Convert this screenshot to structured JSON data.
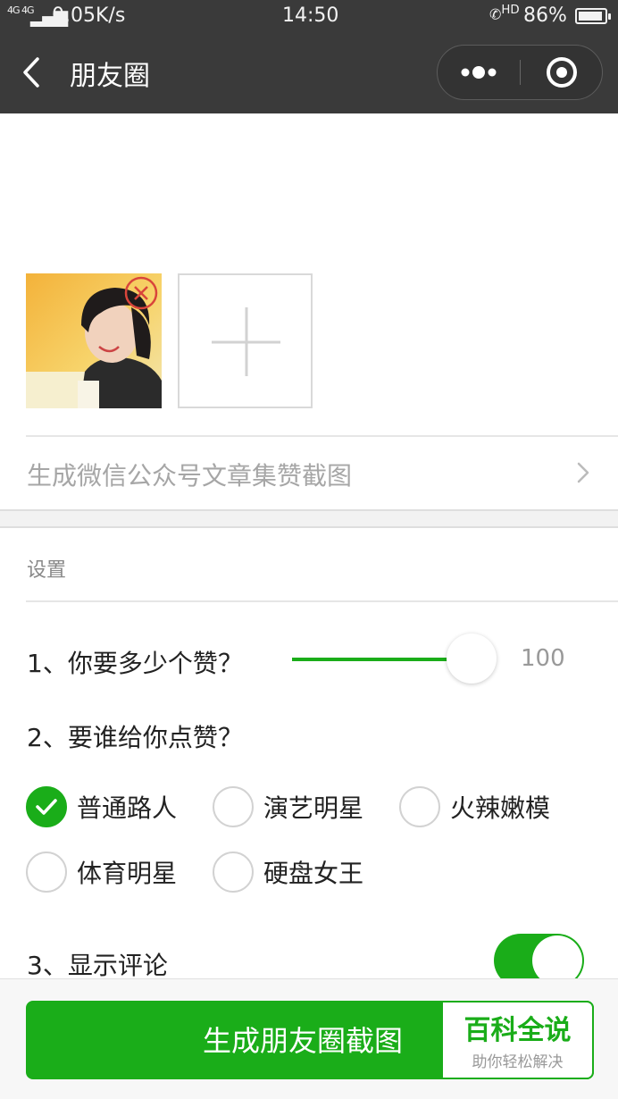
{
  "status_bar": {
    "network": "4G 4G",
    "speed": "0.05K/s",
    "time": "14:50",
    "hd_badge": "HD",
    "battery_percent": "86%",
    "battery_level": 0.86
  },
  "nav": {
    "title": "朋友圈",
    "icons": [
      "back-chevron-icon",
      "more-dots-icon",
      "close-target-icon"
    ]
  },
  "images": {
    "thumbnail_icon": "remove-x-icon",
    "add_icon": "plus-icon"
  },
  "article_link": {
    "label": "生成微信公众号文章集赞截图",
    "icon": "chevron-right-icon"
  },
  "settings": {
    "header": "设置",
    "q1": {
      "label": "1、你要多少个赞？",
      "value": "100",
      "fill_fraction": 0.88
    },
    "q2": {
      "label": "2、要谁给你点赞？",
      "options": [
        {
          "label": "普通路人",
          "checked": true
        },
        {
          "label": "演艺明星",
          "checked": false
        },
        {
          "label": "火辣嫩模",
          "checked": false
        },
        {
          "label": "体育明星",
          "checked": false
        },
        {
          "label": "硬盘女王",
          "checked": false
        }
      ]
    },
    "q3": {
      "label": "3、显示评论",
      "toggle_on": true
    }
  },
  "bottom": {
    "generate_label": "生成朋友圈截图",
    "watermark_title": "百科全说",
    "watermark_sub": "助你轻松解决"
  },
  "colors": {
    "accent": "#1aad19",
    "nav_bg": "#3a3a3a"
  }
}
